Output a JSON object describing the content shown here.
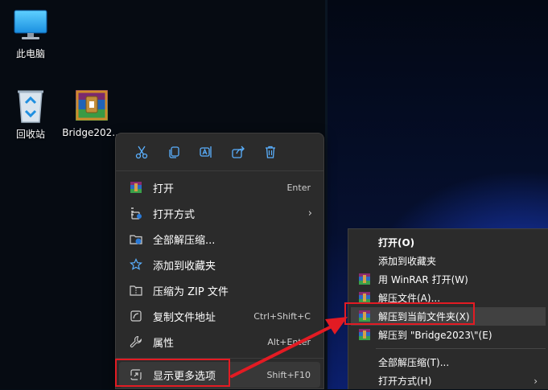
{
  "desktop": {
    "icons": [
      {
        "label": "此电脑",
        "icon": "monitor-icon"
      },
      {
        "label": "回收站",
        "icon": "recycle-bin-icon"
      },
      {
        "label": "Bridge202...",
        "icon": "winrar-archive-icon"
      }
    ]
  },
  "context_menu": {
    "quick_actions": [
      "cut-icon",
      "copy-icon",
      "rename-icon",
      "share-icon",
      "delete-icon"
    ],
    "items": [
      {
        "label": "打开",
        "shortcut": "Enter"
      },
      {
        "label": "打开方式",
        "has_submenu": true
      },
      {
        "label": "全部解压缩..."
      },
      {
        "label": "添加到收藏夹"
      },
      {
        "label": "压缩为 ZIP 文件"
      },
      {
        "label": "复制文件地址",
        "shortcut": "Ctrl+Shift+C"
      },
      {
        "label": "属性",
        "shortcut": "Alt+Enter"
      },
      {
        "label": "显示更多选项",
        "shortcut": "Shift+F10"
      }
    ]
  },
  "classic_menu": {
    "items": [
      {
        "label": "打开(O)"
      },
      {
        "label": "添加到收藏夹"
      },
      {
        "label": "用 WinRAR 打开(W)"
      },
      {
        "label": "解压文件(A)..."
      },
      {
        "label": "解压到当前文件夹(X)"
      },
      {
        "label": "解压到 \"Bridge2023\\\"(E)"
      },
      {
        "label": "全部解压缩(T)..."
      },
      {
        "label": "打开方式(H)",
        "has_submenu": true
      }
    ]
  },
  "colors": {
    "highlight_box": "#e31b23",
    "menu_bg": "#2b2b2b",
    "arrow": "#e31b23"
  }
}
